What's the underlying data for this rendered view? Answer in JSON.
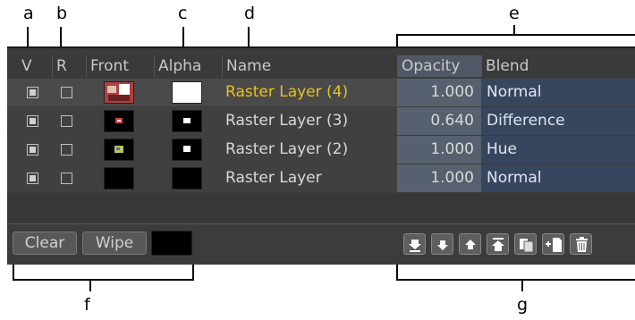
{
  "callouts": {
    "a": "a",
    "b": "b",
    "c": "c",
    "d": "d",
    "e": "e",
    "f": "f",
    "g": "g"
  },
  "headers": {
    "v": "V",
    "r": "R",
    "front": "Front",
    "alpha": "Alpha",
    "name": "Name",
    "opacity": "Opacity",
    "blend": "Blend"
  },
  "layers": [
    {
      "name": "Raster Layer (4)",
      "opacity": "1.000",
      "blend": "Normal",
      "visible": true,
      "selected": true
    },
    {
      "name": "Raster Layer (3)",
      "opacity": "0.640",
      "blend": "Difference",
      "visible": true,
      "selected": false
    },
    {
      "name": "Raster Layer (2)",
      "opacity": "1.000",
      "blend": "Hue",
      "visible": true,
      "selected": false
    },
    {
      "name": "Raster Layer",
      "opacity": "1.000",
      "blend": "Normal",
      "visible": true,
      "selected": false
    }
  ],
  "buttons": {
    "clear": "Clear",
    "wipe": "Wipe"
  },
  "icons": [
    "move-to-bottom-icon",
    "move-down-icon",
    "move-up-icon",
    "move-to-top-icon",
    "duplicate-layer-icon",
    "new-layer-icon",
    "delete-layer-icon"
  ],
  "colors": {
    "selected_name": "#e8c020",
    "opacity_bg": "#56606e",
    "blend_bg": "#37465f",
    "panel_bg": "#3c3c3c"
  }
}
